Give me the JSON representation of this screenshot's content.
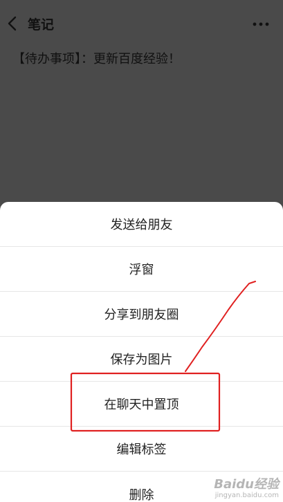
{
  "header": {
    "title": "笔记",
    "back_icon": "chevron-left-icon",
    "more_icon": "more-horizontal-icon"
  },
  "note": {
    "content": "【待办事项】：更新百度经验！"
  },
  "menu": {
    "items": [
      {
        "label": "发送给朋友"
      },
      {
        "label": "浮窗"
      },
      {
        "label": "分享到朋友圈"
      },
      {
        "label": "保存为图片"
      },
      {
        "label": "在聊天中置顶"
      },
      {
        "label": "编辑标签"
      },
      {
        "label": "删除"
      }
    ]
  },
  "annotation": {
    "highlight_color": "#e02020"
  },
  "watermark": {
    "brand": "Baidu经验",
    "url": "jingyan.baidu.com"
  }
}
